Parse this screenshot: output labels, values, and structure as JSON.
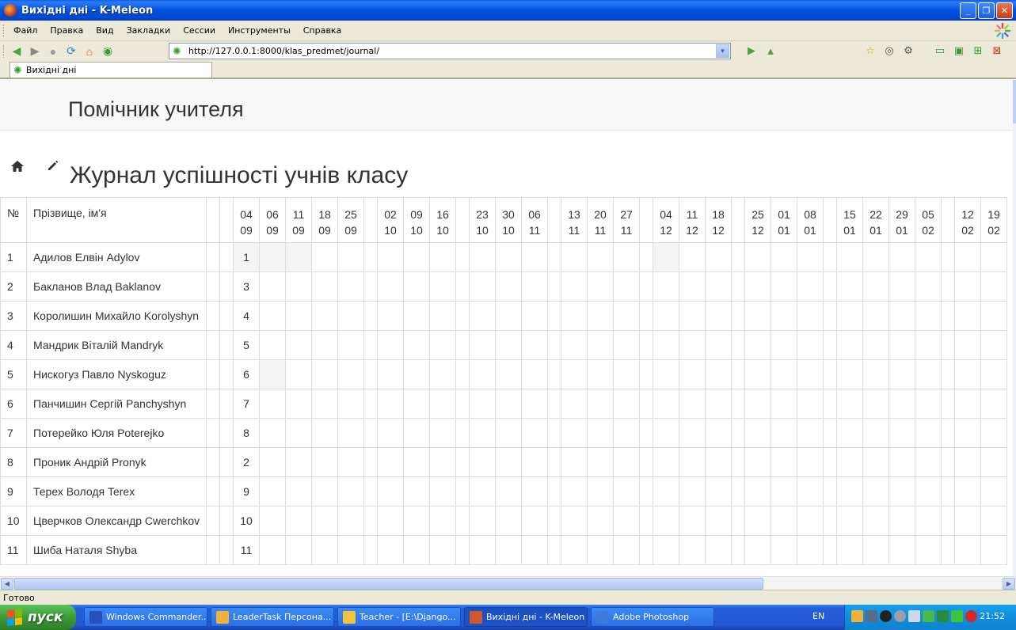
{
  "window": {
    "title": "Вихідні дні - K-Meleon"
  },
  "menu": [
    "Файл",
    "Правка",
    "Вид",
    "Закладки",
    "Сессии",
    "Инструменты",
    "Справка"
  ],
  "nav": {
    "url": "http://127.0.0.1:8000/klas_predmet/journal/"
  },
  "tab": {
    "label": "Вихідні дні"
  },
  "page": {
    "brand": "Помічник учителя",
    "title": "Журнал успішності учнів класу"
  },
  "journal": {
    "header_num": "№",
    "header_name": "Прізвище, ім'я",
    "columns": [
      {
        "d": "",
        "m": ""
      },
      {
        "d": "",
        "m": ""
      },
      {
        "d": "04",
        "m": "09"
      },
      {
        "d": "06",
        "m": "09"
      },
      {
        "d": "11",
        "m": "09"
      },
      {
        "d": "18",
        "m": "09"
      },
      {
        "d": "25",
        "m": "09"
      },
      {
        "d": "",
        "m": ""
      },
      {
        "d": "02",
        "m": "10"
      },
      {
        "d": "09",
        "m": "10"
      },
      {
        "d": "16",
        "m": "10"
      },
      {
        "d": "",
        "m": ""
      },
      {
        "d": "23",
        "m": "10"
      },
      {
        "d": "30",
        "m": "10"
      },
      {
        "d": "06",
        "m": "11"
      },
      {
        "d": "",
        "m": ""
      },
      {
        "d": "13",
        "m": "11"
      },
      {
        "d": "20",
        "m": "11"
      },
      {
        "d": "27",
        "m": "11"
      },
      {
        "d": "",
        "m": ""
      },
      {
        "d": "04",
        "m": "12"
      },
      {
        "d": "11",
        "m": "12"
      },
      {
        "d": "18",
        "m": "12"
      },
      {
        "d": "",
        "m": ""
      },
      {
        "d": "25",
        "m": "12"
      },
      {
        "d": "01",
        "m": "01"
      },
      {
        "d": "08",
        "m": "01"
      },
      {
        "d": "",
        "m": ""
      },
      {
        "d": "15",
        "m": "01"
      },
      {
        "d": "22",
        "m": "01"
      },
      {
        "d": "29",
        "m": "01"
      },
      {
        "d": "05",
        "m": "02"
      },
      {
        "d": "",
        "m": ""
      },
      {
        "d": "12",
        "m": "02"
      },
      {
        "d": "19",
        "m": "02"
      }
    ],
    "rows": [
      {
        "num": "1",
        "name": "Адилов Елвін Adylov",
        "grade": "1"
      },
      {
        "num": "2",
        "name": "Бакланов Влад Baklanov",
        "grade": "3"
      },
      {
        "num": "3",
        "name": "Королишин Михайло Korolyshyn",
        "grade": "4"
      },
      {
        "num": "4",
        "name": "Мандрик Віталій Mandryk",
        "grade": "5"
      },
      {
        "num": "5",
        "name": "Нискогуз Павло Nyskoguz",
        "grade": "6"
      },
      {
        "num": "6",
        "name": "Панчишин Сергій Panchyshyn",
        "grade": "7"
      },
      {
        "num": "7",
        "name": "Потерейко Юля Poterejko",
        "grade": "8"
      },
      {
        "num": "8",
        "name": "Проник Андрій Pronyk",
        "grade": "2"
      },
      {
        "num": "9",
        "name": "Терех Володя Terex",
        "grade": "9"
      },
      {
        "num": "10",
        "name": "Цверчков Олександр Cwerchkov",
        "grade": "10"
      },
      {
        "num": "11",
        "name": "Шиба Наталя Shyba",
        "grade": "11"
      }
    ]
  },
  "status": {
    "text": "Готово"
  },
  "taskbar": {
    "start": "пуск",
    "tasks": [
      {
        "label": "Windows Commander...",
        "color": "#2a4fb8"
      },
      {
        "label": "LeaderTask Персона...",
        "color": "#f2b13a"
      },
      {
        "label": "Teacher - [E:\\Django...",
        "color": "#f3c33b"
      },
      {
        "label": "Вихідні дні - K-Meleon",
        "color": "#d0582c"
      },
      {
        "label": "Adobe Photoshop",
        "color": "#3b7dd6"
      }
    ],
    "lang": "EN",
    "clock": "21:52"
  }
}
